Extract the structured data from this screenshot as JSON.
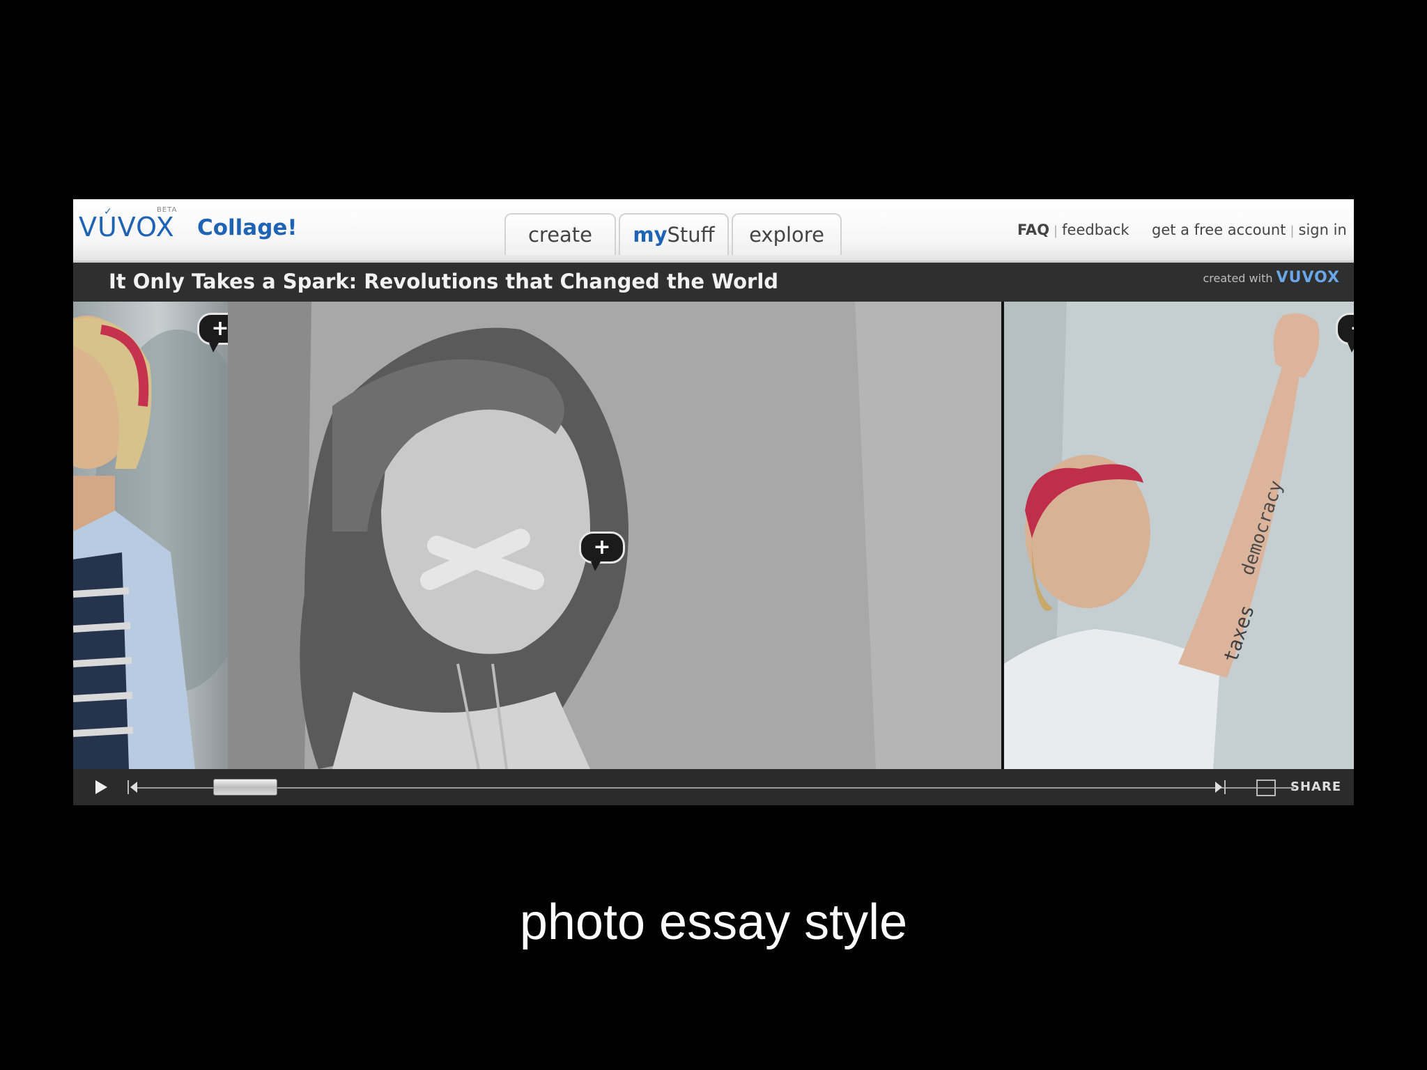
{
  "app": {
    "logo_text": "VUVOX",
    "logo_badge": "BETA",
    "product": "Collage!"
  },
  "tabs": [
    {
      "label_prefix": "",
      "label": "create"
    },
    {
      "label_prefix": "my",
      "label": "Stuff"
    },
    {
      "label_prefix": "",
      "label": "explore"
    }
  ],
  "links": {
    "faq": "FAQ",
    "feedback": "feedback",
    "free_account": "get a free account",
    "sign_in": "sign in",
    "separator": "|"
  },
  "collage": {
    "title": "It Only Takes a Spark: Revolutions that Changed the World",
    "created_with_label": "created with",
    "created_with_brand": "VUVOX"
  },
  "photos": [
    {
      "name": "girl looking up"
    },
    {
      "name": "girl with taped mouth"
    },
    {
      "name": "girl with words on arm",
      "arm_text": [
        "democracy",
        "taxes"
      ]
    }
  ],
  "hotspot_symbol": "+",
  "controls": {
    "share_label": "SHARE",
    "progress": 0.04
  },
  "slide_caption": "photo essay style",
  "colors": {
    "brand_blue": "#1f63b5",
    "title_bar": "#2f2f2f",
    "background": "#000000"
  }
}
